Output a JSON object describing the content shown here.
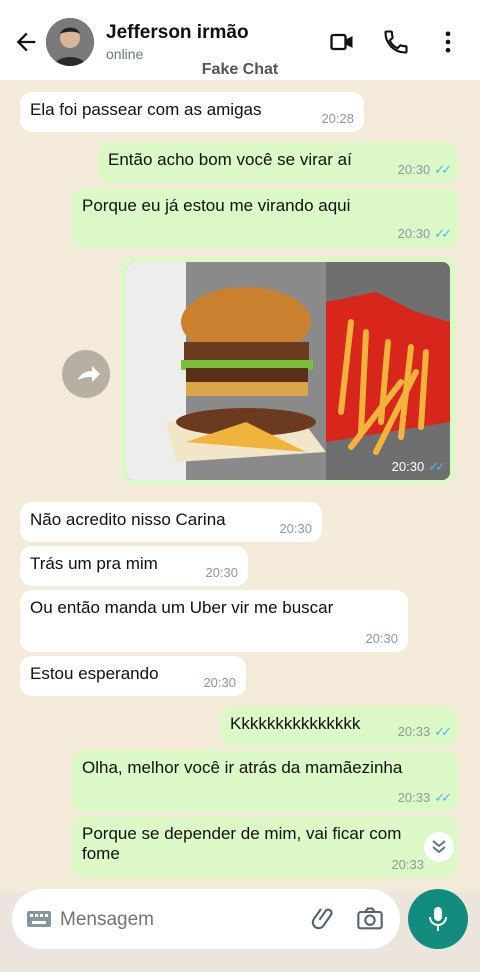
{
  "header": {
    "contact_name": "Jefferson irmão",
    "status": "online",
    "watermark": "Fake Chat"
  },
  "messages": [
    {
      "text": "Ela foi passear com as amigas",
      "time": "20:28",
      "dir": "in"
    },
    {
      "text": "Então acho bom você se virar aí",
      "time": "20:30",
      "dir": "out"
    },
    {
      "text": "Porque eu já estou me virando aqui",
      "time": "20:30",
      "dir": "out"
    },
    {
      "image": "burger-and-fries-photo",
      "time": "20:30",
      "dir": "out"
    },
    {
      "text": "Não acredito nisso Carina",
      "time": "20:30",
      "dir": "in"
    },
    {
      "text": "Trás um pra mim",
      "time": "20:30",
      "dir": "in"
    },
    {
      "text": "Ou então manda um Uber vir me buscar",
      "time": "20:30",
      "dir": "in"
    },
    {
      "text": "Estou esperando",
      "time": "20:30",
      "dir": "in"
    },
    {
      "text": "Kkkkkkkkkkkkkkk",
      "time": "20:33",
      "dir": "out"
    },
    {
      "text": "Olha, melhor você ir atrás da mamãezinha",
      "time": "20:33",
      "dir": "out"
    },
    {
      "text": "Porque se depender de mim, vai ficar com fome",
      "time": "20:33",
      "dir": "out"
    }
  ],
  "input": {
    "placeholder": "Mensagem"
  },
  "colors": {
    "outgoing": "#dcf8c6",
    "incoming": "#ffffff",
    "accent": "#128c7e",
    "read_ticks": "#4fb6ec"
  }
}
